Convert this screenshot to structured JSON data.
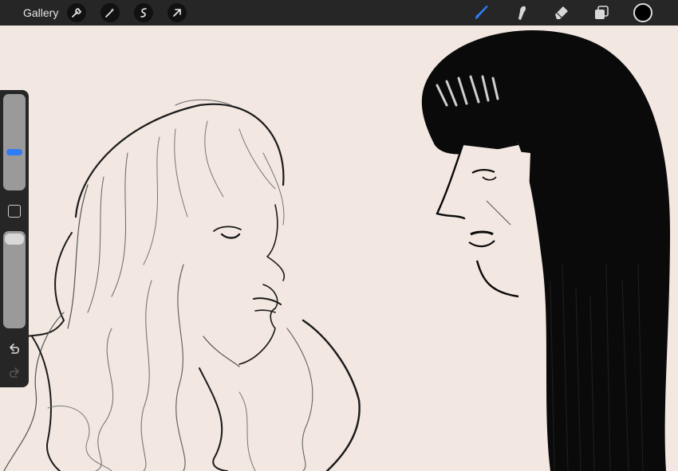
{
  "topbar": {
    "gallery_label": "Gallery",
    "left_tools": [
      "wrench-icon",
      "magic-wand-icon",
      "selection-icon",
      "transform-arrow-icon"
    ],
    "right_tools": [
      "brush-icon",
      "smudge-icon",
      "eraser-icon",
      "layers-icon"
    ],
    "active_tool": "brush-icon",
    "accent_color": "#2e7cf6",
    "current_color": "#000000"
  },
  "sidebar": {
    "brush_size_level": 0.4,
    "opacity_level": 0.0,
    "controls": [
      "brush-size-slider",
      "modify-button",
      "opacity-slider",
      "undo-button",
      "redo-button"
    ]
  },
  "canvas": {
    "background_color": "#f2e7e1"
  }
}
